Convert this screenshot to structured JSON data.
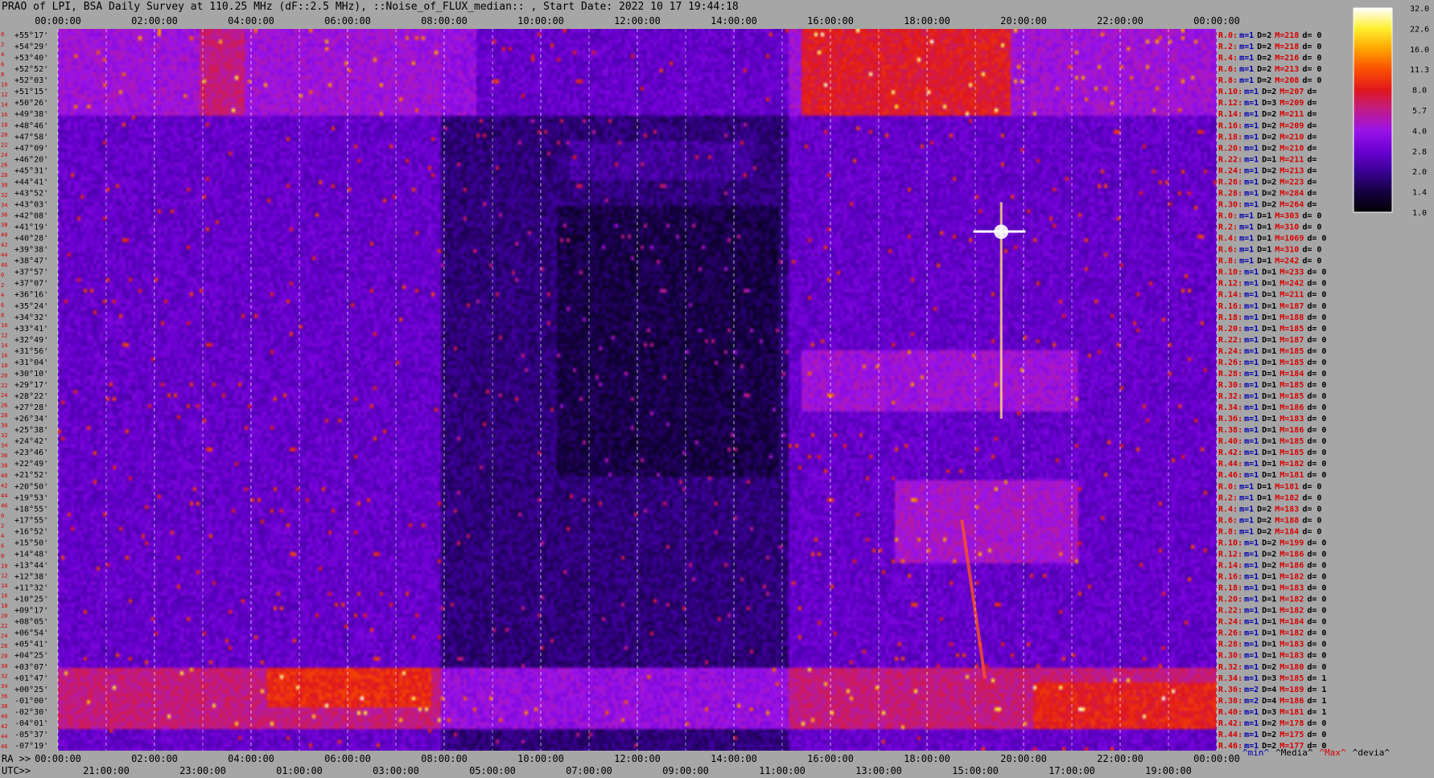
{
  "title": "PRAO of LPI, BSA Daily Survey at 110.25 MHz (dF::2.5 MHz), ::Noise_of_FLUX_median:: , Start Date: 2022 10 17 19:44:18",
  "chart_data": {
    "type": "heatmap",
    "title": "PRAO of LPI, BSA Daily Survey at 110.25 MHz (dF::2.5 MHz), ::Noise_of_FLUX_median:: , Start Date: 2022 10 17 19:44:18",
    "x_top_ticks": [
      "00:00:00",
      "02:00:00",
      "04:00:00",
      "06:00:00",
      "08:00:00",
      "10:00:00",
      "12:00:00",
      "14:00:00",
      "16:00:00",
      "18:00:00",
      "20:00:00",
      "22:00:00",
      "00:00:00"
    ],
    "x_bottom_ra_prefix": "RA >>",
    "x_bottom_ra_ticks": [
      "00:00:00",
      "02:00:00",
      "04:00:00",
      "06:00:00",
      "08:00:00",
      "10:00:00",
      "12:00:00",
      "14:00:00",
      "16:00:00",
      "18:00:00",
      "20:00:00",
      "22:00:00",
      "00:00:00"
    ],
    "x_bottom_utc_prefix": "UTC>>",
    "x_bottom_utc_ticks": [
      "21:00:00",
      "23:00:00",
      "01:00:00",
      "03:00:00",
      "05:00:00",
      "07:00:00",
      "09:00:00",
      "11:00:00",
      "13:00:00",
      "15:00:00",
      "17:00:00",
      "19:00:00"
    ],
    "y_ticks": [
      "+55°17'",
      "+54°29'",
      "+53°40'",
      "+52°52'",
      "+52°03'",
      "+51°15'",
      "+50°26'",
      "+49°38'",
      "+48°46'",
      "+47°58'",
      "+47°09'",
      "+46°20'",
      "+45°31'",
      "+44°41'",
      "+43°52'",
      "+43°03'",
      "+42°08'",
      "+41°19'",
      "+40°28'",
      "+39°38'",
      "+38°47'",
      "+37°57'",
      "+37°07'",
      "+36°16'",
      "+35°24'",
      "+34°32'",
      "+33°41'",
      "+32°49'",
      "+31°56'",
      "+31°04'",
      "+30°10'",
      "+29°17'",
      "+28°22'",
      "+27°28'",
      "+26°34'",
      "+25°38'",
      "+24°42'",
      "+23°46'",
      "+22°49'",
      "+21°52'",
      "+20°50'",
      "+19°53'",
      "+18°55'",
      "+17°55'",
      "+16°52'",
      "+15°50'",
      "+14°48'",
      "+13°44'",
      "+12°38'",
      "+11°32'",
      "+10°25'",
      "+09°17'",
      "+08°05'",
      "+06°54'",
      "+05°41'",
      "+04°25'",
      "+03°07'",
      "+01°47'",
      "+00°25'",
      "-01°00'",
      "-02°30'",
      "-04°01'",
      "-05°37'",
      "-07°19'"
    ],
    "row_index_labels": [
      "0",
      "2",
      "4",
      "6",
      "8",
      "10",
      "12",
      "14",
      "16",
      "18",
      "20",
      "22",
      "24",
      "26",
      "28",
      "30",
      "32",
      "34",
      "36",
      "38",
      "40",
      "42",
      "44",
      "46",
      "0",
      "2",
      "4",
      "6",
      "8",
      "10",
      "12",
      "14",
      "16",
      "18",
      "20",
      "22",
      "24",
      "26",
      "28",
      "30",
      "32",
      "34",
      "36",
      "38",
      "40",
      "42",
      "44",
      "46",
      "0",
      "2",
      "4",
      "6",
      "8",
      "10",
      "12",
      "14",
      "16",
      "18",
      "20",
      "22",
      "24",
      "26",
      "28",
      "30",
      "32",
      "34",
      "36",
      "38",
      "40",
      "42",
      "44",
      "46"
    ],
    "right_stats": [
      {
        "r": "R.0:",
        "m": "m=1",
        "D": "D=2",
        "M": "M=218",
        "d": "d= 0"
      },
      {
        "r": "R.2:",
        "m": "m=1",
        "D": "D=2",
        "M": "M=218",
        "d": "d= 0"
      },
      {
        "r": "R.4:",
        "m": "m=1",
        "D": "D=2",
        "M": "M=216",
        "d": "d= 0"
      },
      {
        "r": "R.6:",
        "m": "m=1",
        "D": "D=2",
        "M": "M=213",
        "d": "d= 0"
      },
      {
        "r": "R.8:",
        "m": "m=1",
        "D": "D=2",
        "M": "M=208",
        "d": "d= 0"
      },
      {
        "r": "R.10:",
        "m": "m=1",
        "D": "D=2",
        "M": "M=207",
        "d": "d="
      },
      {
        "r": "R.12:",
        "m": "m=1",
        "D": "D=3",
        "M": "M=209",
        "d": "d="
      },
      {
        "r": "R.14:",
        "m": "m=1",
        "D": "D=2",
        "M": "M=211",
        "d": "d="
      },
      {
        "r": "R.16:",
        "m": "m=1",
        "D": "D=2",
        "M": "M=209",
        "d": "d="
      },
      {
        "r": "R.18:",
        "m": "m=1",
        "D": "D=2",
        "M": "M=210",
        "d": "d="
      },
      {
        "r": "R.20:",
        "m": "m=1",
        "D": "D=2",
        "M": "M=210",
        "d": "d="
      },
      {
        "r": "R.22:",
        "m": "m=1",
        "D": "D=1",
        "M": "M=211",
        "d": "d="
      },
      {
        "r": "R.24:",
        "m": "m=1",
        "D": "D=2",
        "M": "M=213",
        "d": "d="
      },
      {
        "r": "R.26:",
        "m": "m=1",
        "D": "D=2",
        "M": "M=223",
        "d": "d="
      },
      {
        "r": "R.28:",
        "m": "m=1",
        "D": "D=2",
        "M": "M=284",
        "d": "d="
      },
      {
        "r": "R.30:",
        "m": "m=1",
        "D": "D=2",
        "M": "M=264",
        "d": "d="
      },
      {
        "r": "R.0:",
        "m": "m=1",
        "D": "D=1",
        "M": "M=303",
        "d": "d= 0"
      },
      {
        "r": "R.2:",
        "m": "m=1",
        "D": "D=1",
        "M": "M=310",
        "d": "d= 0"
      },
      {
        "r": "R.4:",
        "m": "m=1",
        "D": "D=1",
        "M": "M=1069",
        "d": "d= 0"
      },
      {
        "r": "R.6:",
        "m": "m=1",
        "D": "D=1",
        "M": "M=310",
        "d": "d= 0"
      },
      {
        "r": "R.8:",
        "m": "m=1",
        "D": "D=1",
        "M": "M=242",
        "d": "d= 0"
      },
      {
        "r": "R.10:",
        "m": "m=1",
        "D": "D=1",
        "M": "M=233",
        "d": "d= 0"
      },
      {
        "r": "R.12:",
        "m": "m=1",
        "D": "D=1",
        "M": "M=242",
        "d": "d= 0"
      },
      {
        "r": "R.14:",
        "m": "m=1",
        "D": "D=1",
        "M": "M=211",
        "d": "d= 0"
      },
      {
        "r": "R.16:",
        "m": "m=1",
        "D": "D=1",
        "M": "M=187",
        "d": "d= 0"
      },
      {
        "r": "R.18:",
        "m": "m=1",
        "D": "D=1",
        "M": "M=188",
        "d": "d= 0"
      },
      {
        "r": "R.20:",
        "m": "m=1",
        "D": "D=1",
        "M": "M=185",
        "d": "d= 0"
      },
      {
        "r": "R.22:",
        "m": "m=1",
        "D": "D=1",
        "M": "M=187",
        "d": "d= 0"
      },
      {
        "r": "R.24:",
        "m": "m=1",
        "D": "D=1",
        "M": "M=185",
        "d": "d= 0"
      },
      {
        "r": "R.26:",
        "m": "m=1",
        "D": "D=1",
        "M": "M=185",
        "d": "d= 0"
      },
      {
        "r": "R.28:",
        "m": "m=1",
        "D": "D=1",
        "M": "M=184",
        "d": "d= 0"
      },
      {
        "r": "R.30:",
        "m": "m=1",
        "D": "D=1",
        "M": "M=185",
        "d": "d= 0"
      },
      {
        "r": "R.32:",
        "m": "m=1",
        "D": "D=1",
        "M": "M=185",
        "d": "d= 0"
      },
      {
        "r": "R.34:",
        "m": "m=1",
        "D": "D=1",
        "M": "M=186",
        "d": "d= 0"
      },
      {
        "r": "R.36:",
        "m": "m=1",
        "D": "D=1",
        "M": "M=183",
        "d": "d= 0"
      },
      {
        "r": "R.38:",
        "m": "m=1",
        "D": "D=1",
        "M": "M=186",
        "d": "d= 0"
      },
      {
        "r": "R.40:",
        "m": "m=1",
        "D": "D=1",
        "M": "M=185",
        "d": "d= 0"
      },
      {
        "r": "R.42:",
        "m": "m=1",
        "D": "D=1",
        "M": "M=185",
        "d": "d= 0"
      },
      {
        "r": "R.44:",
        "m": "m=1",
        "D": "D=1",
        "M": "M=182",
        "d": "d= 0"
      },
      {
        "r": "R.46:",
        "m": "m=1",
        "D": "D=1",
        "M": "M=181",
        "d": "d= 0"
      },
      {
        "r": "R.0:",
        "m": "m=1",
        "D": "D=1",
        "M": "M=181",
        "d": "d= 0"
      },
      {
        "r": "R.2:",
        "m": "m=1",
        "D": "D=1",
        "M": "M=182",
        "d": "d= 0"
      },
      {
        "r": "R.4:",
        "m": "m=1",
        "D": "D=2",
        "M": "M=183",
        "d": "d= 0"
      },
      {
        "r": "R.6:",
        "m": "m=1",
        "D": "D=2",
        "M": "M=188",
        "d": "d= 0"
      },
      {
        "r": "R.8:",
        "m": "m=1",
        "D": "D=2",
        "M": "M=184",
        "d": "d= 0"
      },
      {
        "r": "R.10:",
        "m": "m=1",
        "D": "D=2",
        "M": "M=199",
        "d": "d= 0"
      },
      {
        "r": "R.12:",
        "m": "m=1",
        "D": "D=2",
        "M": "M=186",
        "d": "d= 0"
      },
      {
        "r": "R.14:",
        "m": "m=1",
        "D": "D=2",
        "M": "M=186",
        "d": "d= 0"
      },
      {
        "r": "R.16:",
        "m": "m=1",
        "D": "D=1",
        "M": "M=182",
        "d": "d= 0"
      },
      {
        "r": "R.18:",
        "m": "m=1",
        "D": "D=1",
        "M": "M=183",
        "d": "d= 0"
      },
      {
        "r": "R.20:",
        "m": "m=1",
        "D": "D=1",
        "M": "M=182",
        "d": "d= 0"
      },
      {
        "r": "R.22:",
        "m": "m=1",
        "D": "D=1",
        "M": "M=182",
        "d": "d= 0"
      },
      {
        "r": "R.24:",
        "m": "m=1",
        "D": "D=1",
        "M": "M=184",
        "d": "d= 0"
      },
      {
        "r": "R.26:",
        "m": "m=1",
        "D": "D=1",
        "M": "M=182",
        "d": "d= 0"
      },
      {
        "r": "R.28:",
        "m": "m=1",
        "D": "D=1",
        "M": "M=183",
        "d": "d= 0"
      },
      {
        "r": "R.30:",
        "m": "m=1",
        "D": "D=1",
        "M": "M=183",
        "d": "d= 0"
      },
      {
        "r": "R.32:",
        "m": "m=1",
        "D": "D=2",
        "M": "M=180",
        "d": "d= 0"
      },
      {
        "r": "R.34:",
        "m": "m=1",
        "D": "D=3",
        "M": "M=185",
        "d": "d= 1"
      },
      {
        "r": "R.36:",
        "m": "m=2",
        "D": "D=4",
        "M": "M=189",
        "d": "d= 1"
      },
      {
        "r": "R.38:",
        "m": "m=2",
        "D": "D=4",
        "M": "M=186",
        "d": "d= 1"
      },
      {
        "r": "R.40:",
        "m": "m=1",
        "D": "D=3",
        "M": "M=181",
        "d": "d= 1"
      },
      {
        "r": "R.42:",
        "m": "m=1",
        "D": "D=2",
        "M": "M=178",
        "d": "d= 0"
      },
      {
        "r": "R.44:",
        "m": "m=1",
        "D": "D=2",
        "M": "M=175",
        "d": "d= 0"
      },
      {
        "r": "R.46:",
        "m": "m=1",
        "D": "D=2",
        "M": "M=177",
        "d": "d= 0"
      }
    ],
    "stats_legend": [
      "^min^",
      "^Media^",
      "^Max^",
      "^devia^"
    ],
    "colorbar": {
      "ticks": [
        "32.0",
        "22.6",
        "16.0",
        "11.3",
        "8.0",
        "5.7",
        "4.0",
        "2.8",
        "2.0",
        "1.4",
        "1.0"
      ],
      "colormap": [
        "#000000",
        "#140040",
        "#3a0094",
        "#6a00d2",
        "#9a14e8",
        "#c01c88",
        "#e0181c",
        "#fa5000",
        "#ffa400",
        "#fff030",
        "#ffffff"
      ]
    },
    "colors": {
      "background": "#a6a6a6",
      "stats_label": "#d80000",
      "stats_m": "#0000b0",
      "stats_M": "#d80000",
      "dashed_grid": "#ffffff"
    },
    "grid": "dashed vertical lines"
  }
}
